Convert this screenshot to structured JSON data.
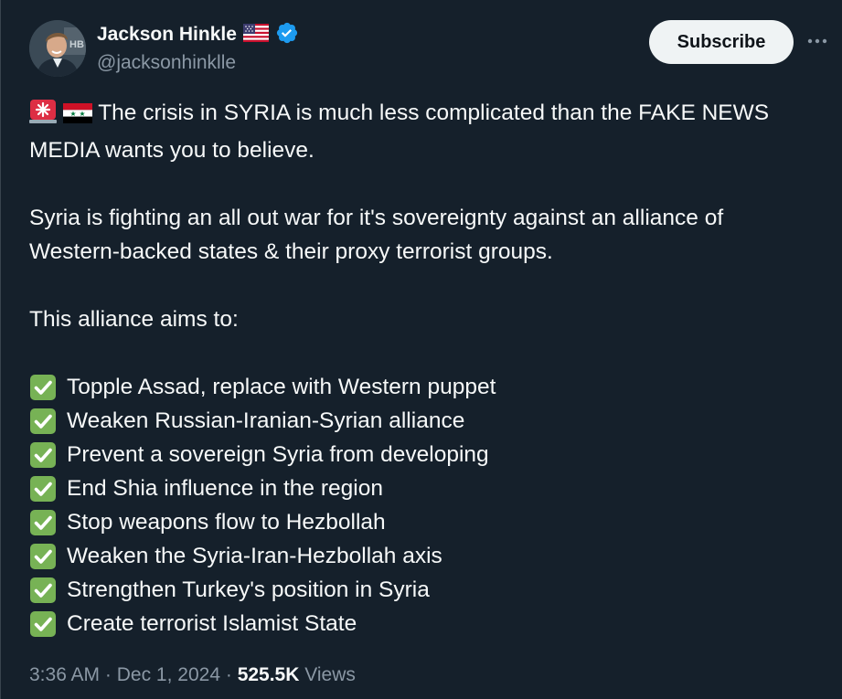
{
  "author": {
    "display_name": "Jackson Hinkle",
    "handle": "@jacksonhinklle",
    "flag_icon": "us-flag-icon",
    "verified_icon": "verified-badge-icon",
    "verified_color": "#1d9bf0"
  },
  "header": {
    "subscribe_label": "Subscribe",
    "more_icon": "more-horizontal-icon"
  },
  "tweet": {
    "lead_icons": [
      "rotating-light-icon",
      "syria-flag-icon"
    ],
    "line1": "The crisis in SYRIA is much less complicated than the FAKE NEWS",
    "line2": "MEDIA wants you to believe.",
    "line3": "Syria is fighting an all out war for it's sovereignty against an alliance of",
    "line4": "Western-backed states & their proxy terrorist groups.",
    "line5": "This alliance aims to:",
    "checklist": [
      "Topple Assad, replace with Western puppet",
      "Weaken Russian-Iranian-Syrian alliance",
      "Prevent a sovereign Syria from developing",
      "End Shia influence in the region",
      "Stop weapons flow to Hezbollah",
      "Weaken the Syria-Iran-Hezbollah axis",
      "Strengthen Turkey's position in Syria",
      "Create terrorist Islamist State"
    ],
    "check_icon": "check-mark-button-icon",
    "check_color": "#77b255"
  },
  "meta": {
    "time": "3:36 AM",
    "separator": "·",
    "date": "Dec 1, 2024",
    "views_count": "525.5K",
    "views_label": "Views"
  },
  "colors": {
    "background": "#15202b",
    "text_primary": "#f7f9f9",
    "text_secondary": "#8b98a5"
  }
}
